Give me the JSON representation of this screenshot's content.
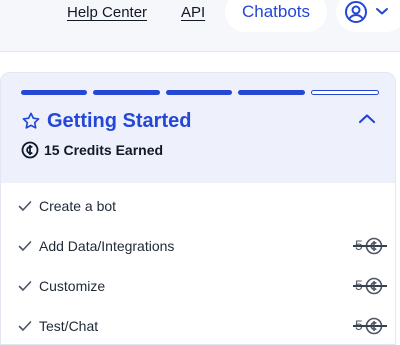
{
  "nav": {
    "help_center": "Help Center",
    "api": "API",
    "chatbots": "Chatbots"
  },
  "icons": {
    "profile": "user-circle-icon",
    "dropdown": "chevron-down-icon",
    "star": "star-icon",
    "collapse": "chevron-up-icon",
    "credit": "credit-coin-icon",
    "check": "check-icon"
  },
  "colors": {
    "accent": "#2447d6",
    "header_bg": "#eef1fc"
  },
  "getting_started": {
    "progress": {
      "completed": 4,
      "total": 5
    },
    "title": "Getting Started",
    "credits_earned": "15 Credits Earned",
    "tasks": [
      {
        "label": "Create a bot",
        "done": true,
        "reward": ""
      },
      {
        "label": "Add Data/Integrations",
        "done": true,
        "reward": "5",
        "reward_claimed": true
      },
      {
        "label": "Customize",
        "done": true,
        "reward": "5",
        "reward_claimed": true
      },
      {
        "label": "Test/Chat",
        "done": true,
        "reward": "5",
        "reward_claimed": true
      }
    ]
  }
}
